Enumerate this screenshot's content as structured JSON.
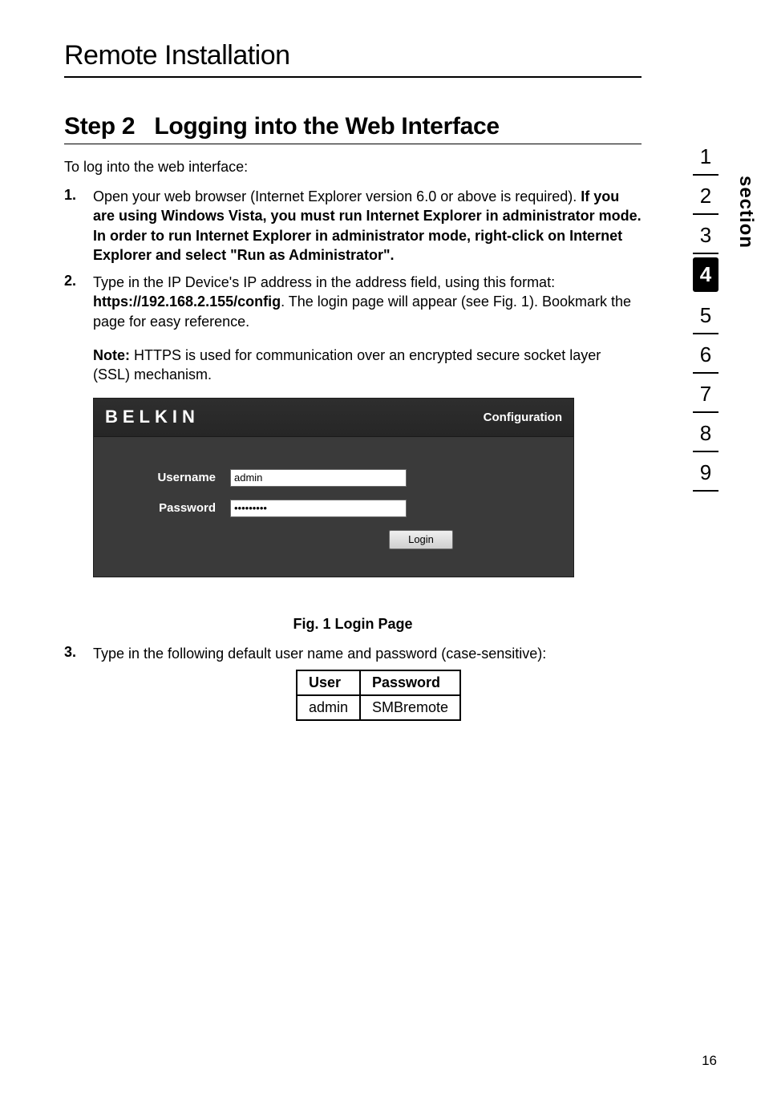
{
  "header": {
    "title": "Remote Installation"
  },
  "step": {
    "label": "Step 2",
    "name": "Logging into the Web Interface",
    "intro": "To log into the web interface:"
  },
  "items": [
    {
      "num": "1.",
      "pre": "Open your web browser (Internet Explorer version 6.0 or above is required). ",
      "bold": "If you are using Windows Vista, you must run Internet Explorer in administrator mode. In order to run Internet Explorer in administrator mode, right-click on Internet Explorer and select \"Run as Administrator\"."
    },
    {
      "num": "2.",
      "pre": "Type in the IP Device's IP address in the address field, using this format: ",
      "bold": "https://192.168.2.155/config",
      "post": ". The login page will appear (see Fig. 1). Bookmark the page for easy reference."
    }
  ],
  "note": {
    "label": "Note:",
    "text": " HTTPS is used for communication over an encrypted secure socket layer (SSL) mechanism."
  },
  "login": {
    "brand": "BELKIN",
    "title": "Configuration",
    "user_label": "Username",
    "pass_label": "Password",
    "user_value": "admin",
    "pass_value": "•••••••••",
    "button": "Login"
  },
  "figure": {
    "caption": "Fig. 1 Login Page"
  },
  "item3": {
    "num": "3.",
    "text": "Type in the following default user name and password (case-sensitive):"
  },
  "cred": {
    "h_user": "User",
    "h_pass": "Password",
    "user": "admin",
    "pass": "SMBremote"
  },
  "tabs": [
    "1",
    "2",
    "3",
    "4",
    "5",
    "6",
    "7",
    "8",
    "9"
  ],
  "active_tab": "4",
  "section_word": "section",
  "page_number": "16"
}
